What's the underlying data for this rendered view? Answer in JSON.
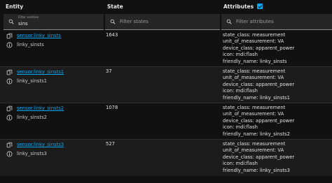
{
  "header": {
    "entity": "Entity",
    "state": "State",
    "attributes": "Attributes",
    "attributes_checked": true,
    "accent_color": "#03a9f4"
  },
  "filters": {
    "entity_label": "Filter entities",
    "entity_value": "sins",
    "state_placeholder": "Filter states",
    "attributes_placeholder": "Filter attributes"
  },
  "rows": [
    {
      "entity_id": "sensor.linky_sinsts",
      "friendly": "linky_sinsts",
      "state": "1643",
      "attrs": [
        "state_class: measurement",
        "unit_of_measurement: VA",
        "device_class: apparent_power",
        "icon: mdi:flash",
        "friendly_name: linky_sinsts"
      ]
    },
    {
      "entity_id": "sensor.linky_sinsts1",
      "friendly": "linky_sinsts1",
      "state": "37",
      "attrs": [
        "state_class: measurement",
        "unit_of_measurement: VA",
        "device_class: apparent_power",
        "icon: mdi:flash",
        "friendly_name: linky_sinsts1"
      ]
    },
    {
      "entity_id": "sensor.linky_sinsts2",
      "friendly": "linky_sinsts2",
      "state": "1078",
      "attrs": [
        "state_class: measurement",
        "unit_of_measurement: VA",
        "device_class: apparent_power",
        "icon: mdi:flash",
        "friendly_name: linky_sinsts2"
      ]
    },
    {
      "entity_id": "sensor.linky_sinsts3",
      "friendly": "linky_sinsts3",
      "state": "527",
      "attrs": [
        "state_class: measurement",
        "unit_of_measurement: VA",
        "device_class: apparent_power",
        "icon: mdi:flash",
        "friendly_name: linky_sinsts3"
      ]
    }
  ],
  "icons": {
    "copy": "copy-icon",
    "info": "info-icon",
    "search": "search-icon"
  }
}
